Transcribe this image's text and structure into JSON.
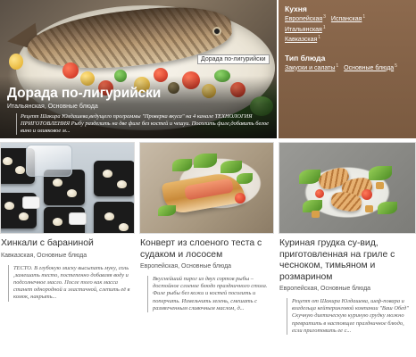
{
  "hero": {
    "title": "Дорада по-лигурийски",
    "meta": "Итальянская, Основные блюда",
    "tag": "Дорада по-лигурийски",
    "description": "Рецепт Шакира Юлдашева,ведущего программы \"Проверка вкуса\" на 4 канале ТЕХНОЛОГИЯ ПРИГОТОВЛЕНИЯ Рыбу разделить на две филе без костей и чешуи. Посолить филе,добавить белое вино и оливковое м..."
  },
  "sidebar": {
    "sections": [
      {
        "heading": "Кухня",
        "items": [
          {
            "label": "Европейская",
            "count": "3"
          },
          {
            "label": "Испанская",
            "count": "1"
          },
          {
            "label": "Итальянская",
            "count": "1"
          },
          {
            "label": "Кавказская",
            "count": "1"
          }
        ]
      },
      {
        "heading": "Тип блюда",
        "items": [
          {
            "label": "Закуски и салаты",
            "count": "1"
          },
          {
            "label": "Основные блюда",
            "count": "5"
          }
        ]
      }
    ]
  },
  "cards": [
    {
      "title": "Хинкали с бараниной",
      "meta": "Кавказская, Основные блюда",
      "description": "ТЕСТО. В глубокую миску высыпать муку, соль ,замешать тесто, постепенно добавляя воду и подсолнечное масло. После того как масса станет однородной и эластичной, слепить её в комок, накрыть..."
    },
    {
      "title": "Конверт из слоеного теста с судаком и лососем",
      "meta": "Европейская, Основные блюда",
      "description": "Вкуснейший пирог из двух сортов рыбы – достойное слоеное блюдо праздничного стола. Филе рыбы без кожи и костей посолить и поперчить. Измельчить зелень, смешать с размягченным сливочным маслом, д..."
    },
    {
      "title": "Куриная грудка су-вид, приготовленная на гриле с чесноком, тимьяном и розмарином",
      "meta": "Европейская, Основные блюда",
      "description": "Рецепт от Шакира Юлдашева, шеф-повара и владельца кейтеринговой компании \"Ваш Обед\" Скучную диетическую куриную грудку можно превратить в настоящее праздничное блюдо, если приготовить ее с..."
    }
  ]
}
